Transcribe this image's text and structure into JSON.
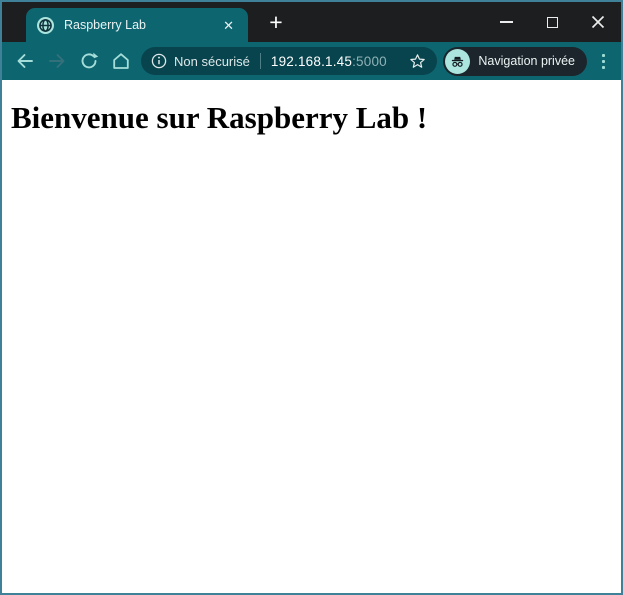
{
  "tab_strip": {
    "tab": {
      "title": "Raspberry Lab",
      "close_glyph": "✕"
    },
    "new_tab_glyph": "+"
  },
  "window_controls": {
    "minimize_icon": "horizontal-line",
    "maximize_icon": "square-outline",
    "close_icon": "x-cross"
  },
  "toolbar": {
    "nav_icons": [
      "back-arrow",
      "forward-arrow",
      "reload",
      "home"
    ],
    "address_bar": {
      "info_icon": "info-circle",
      "security_label": "Non sécurisé",
      "url_host": "192.168.1.45",
      "url_port": ":5000",
      "bookmark_icon": "star-outline"
    },
    "incognito_badge": {
      "icon": "incognito-hat-glasses",
      "label": "Navigation privée"
    },
    "menu_icon": "three-dots-vertical"
  },
  "page": {
    "heading": "Bienvenue sur Raspberry Lab !"
  },
  "colors": {
    "frame_dark": "#1c1e1f",
    "theme_teal": "#0d6570",
    "address_bar_bg": "#08444d",
    "icon_mint": "#a5ded9",
    "badge_bg": "#1b252b",
    "incognito_circle": "#ace4de",
    "window_border": "#40819a",
    "page_bg": "#ffffff",
    "heading_color": "#000000"
  }
}
